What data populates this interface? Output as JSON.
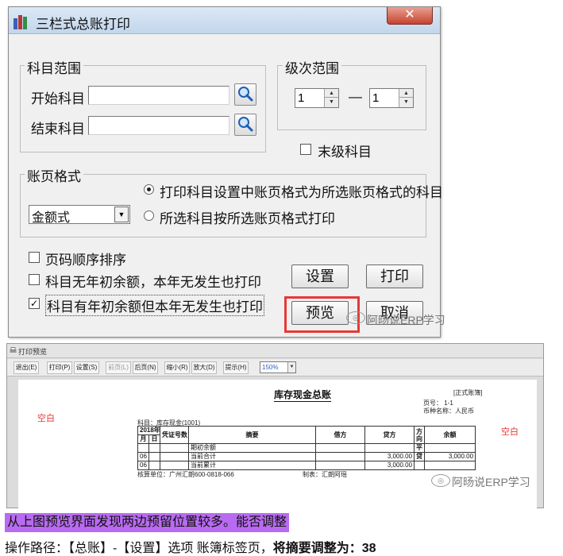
{
  "dialog": {
    "title": "三栏式总账打印",
    "close_glyph": "✕",
    "subject_range": {
      "label": "科目范围",
      "start_label": "开始科目",
      "start_value": "",
      "end_label": "结束科目",
      "end_value": ""
    },
    "level_range": {
      "label": "级次范围",
      "from": "1",
      "to": "1",
      "dash": "—"
    },
    "last_level": {
      "label": "末级科目",
      "checked": false
    },
    "page_format": {
      "label": "账页格式",
      "selected": "金额式",
      "radio1": "打印科目设置中账页格式为所选账页格式的科目",
      "radio2": "所选科目按所选账页格式打印",
      "radio_selected": 1
    },
    "options": [
      {
        "label": "页码顺序排序",
        "checked": false,
        "mark": ""
      },
      {
        "label": "科目无年初余额，本年无发生也打印",
        "checked": false,
        "mark": ""
      },
      {
        "label": "科目有年初余额但本年无发生也打印",
        "checked": true,
        "mark": "✓"
      }
    ],
    "buttons": {
      "settings": "设置",
      "print": "打印",
      "preview": "预览",
      "cancel": "取消"
    }
  },
  "watermark": "阿旸说ERP学习",
  "preview_window": {
    "title": "打印预览",
    "toolbar": [
      {
        "label": "退出(E)",
        "enabled": true
      },
      {
        "label": "打印(P)",
        "enabled": true
      },
      {
        "label": "设置(S)",
        "enabled": true
      },
      {
        "label": "前页(L)",
        "enabled": false
      },
      {
        "label": "后页(N)",
        "enabled": true
      },
      {
        "label": "缩小(R)",
        "enabled": true
      },
      {
        "label": "放大(D)",
        "enabled": true
      },
      {
        "label": "提示(H)",
        "enabled": true
      }
    ],
    "zoom": "150%",
    "zoom_arrow": "▼",
    "report": {
      "title": "库存现金总账",
      "badge": "[正式账簿]",
      "page_info": "页号：   1-1",
      "currency_info": "币种名称：人民币",
      "subject": "科目：库存现金(1001)",
      "left_blank": "空白",
      "right_blank": "空白",
      "headers": {
        "year": "2018年",
        "month": "月",
        "day": "日",
        "voucher": "凭证号数",
        "summary": "摘要",
        "debit": "借方",
        "credit": "贷方",
        "direction": "方向",
        "balance": "余额"
      },
      "rows": [
        {
          "month": "",
          "day": "",
          "voucher": "",
          "summary": "期初余额",
          "debit": "",
          "credit": "",
          "direction": "平",
          "balance": ""
        },
        {
          "month": "06",
          "day": "",
          "voucher": "",
          "summary": "当前合计",
          "debit": "",
          "credit": "3,000.00",
          "direction": "贷",
          "balance": "3,000.00"
        },
        {
          "month": "06",
          "day": "",
          "voucher": "",
          "summary": "当前累计",
          "debit": "",
          "credit": "3,000.00",
          "direction": "",
          "balance": ""
        }
      ],
      "footer_left": "核算单位：广州汇朗600-0818-066",
      "footer_right": "制表：汇朗阿瑶"
    }
  },
  "question": "从上图预览界面发现两边预留位置较多。能否调整",
  "path": {
    "prefix": "操作路径：【总账】-【设置】选项  账簿标签页，",
    "bold": "将摘要调整为：38"
  }
}
